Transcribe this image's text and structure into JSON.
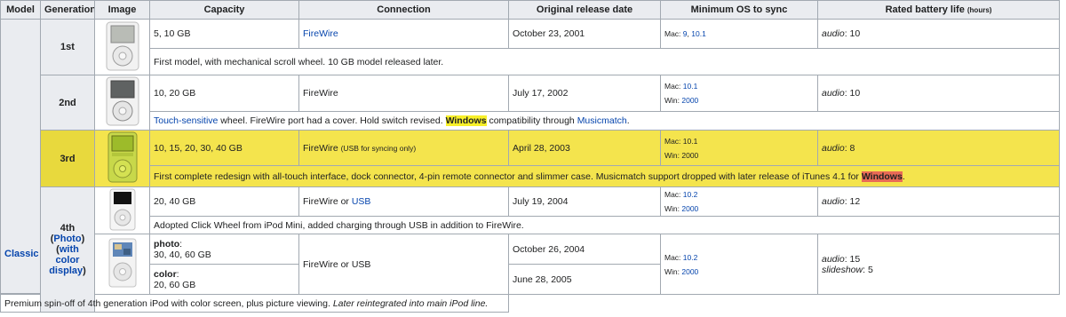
{
  "headers": {
    "model": "Model",
    "generation": "Generation",
    "image": "Image",
    "capacity": "Capacity",
    "connection": "Connection",
    "release": "Original release date",
    "min_os": "Minimum OS to sync",
    "battery": "Rated battery life",
    "battery_unit": "(hours)"
  },
  "model_name": "Classic",
  "rows": {
    "g1": {
      "generation": "1st",
      "capacity": "5, 10 GB",
      "connection": "FireWire",
      "release": "October 23, 2001",
      "mac_label": "Mac:",
      "mac_v1": "9",
      "mac_sep": ",",
      "mac_v2": "10.1",
      "audio_label": "audio",
      "audio_val": ": 10",
      "note": "First model, with mechanical scroll wheel. 10 GB model released later."
    },
    "g2": {
      "generation": "2nd",
      "capacity": "10, 20 GB",
      "connection": "FireWire",
      "release": "July 17, 2002",
      "mac_label": "Mac:",
      "mac_v": "10.1",
      "win_label": "Win:",
      "win_v": "2000",
      "audio_label": "audio",
      "audio_val": ": 10",
      "note_link1": "Touch-sensitive",
      "note_t1": " wheel. FireWire port had a cover. Hold switch revised. ",
      "note_hl": "Windows",
      "note_t2": " compatibility through ",
      "note_link2": "Musicmatch",
      "note_t3": "."
    },
    "g3": {
      "generation": "3rd",
      "capacity": "10, 15, 20, 30, 40 GB",
      "connection": "FireWire",
      "connection_note": "(USB for syncing only)",
      "release": "April 28, 2003",
      "mac_label": "Mac:",
      "mac_v": "10.1",
      "win_label": "Win:",
      "win_v": "2000",
      "audio_label": "audio",
      "audio_val": ": 8",
      "note_t1": "First complete redesign with all-touch interface, dock connector, 4-pin remote connector and slimmer case. Musicmatch support dropped with later release of iTunes 4.1 for ",
      "note_hl": "Windows",
      "note_t2": "."
    },
    "g4": {
      "generation": "4th",
      "gen_link_photo": "Photo",
      "gen_link_color": "with color display",
      "capacity": "20, 40 GB",
      "connection_t": "FireWire or ",
      "connection_link": "USB",
      "release": "July 19, 2004",
      "mac_label": "Mac:",
      "mac_v": "10.2",
      "win_label": "Win:",
      "win_v": "2000",
      "audio_label": "audio",
      "audio_val": ": 12",
      "note": "Adopted Click Wheel from iPod Mini, added charging through USB in addition to FireWire."
    },
    "g4p": {
      "photo_label": "photo",
      "photo_cap": "30, 40, 60 GB",
      "color_label": "color",
      "color_cap": "20, 60 GB",
      "connection": "FireWire or USB",
      "release1": "October 26, 2004",
      "release2": "June 28, 2005",
      "mac_label": "Mac:",
      "mac_v": "10.2",
      "win_label": "Win:",
      "win_v": "2000",
      "audio_label": "audio",
      "audio_val": ": 15",
      "slideshow_label": "slideshow",
      "slideshow_val": ": 5",
      "note_t1": "Premium spin-off of 4th generation iPod with color screen, plus picture viewing. ",
      "note_italic": "Later reintegrated into main iPod line."
    }
  },
  "colors": {
    "header_bg": "#eaecf0",
    "highlight_row": "#f4e44d",
    "link": "#0645ad",
    "windows_highlight_yellow": "#f8f029",
    "windows_highlight_red": "#e96b56"
  }
}
